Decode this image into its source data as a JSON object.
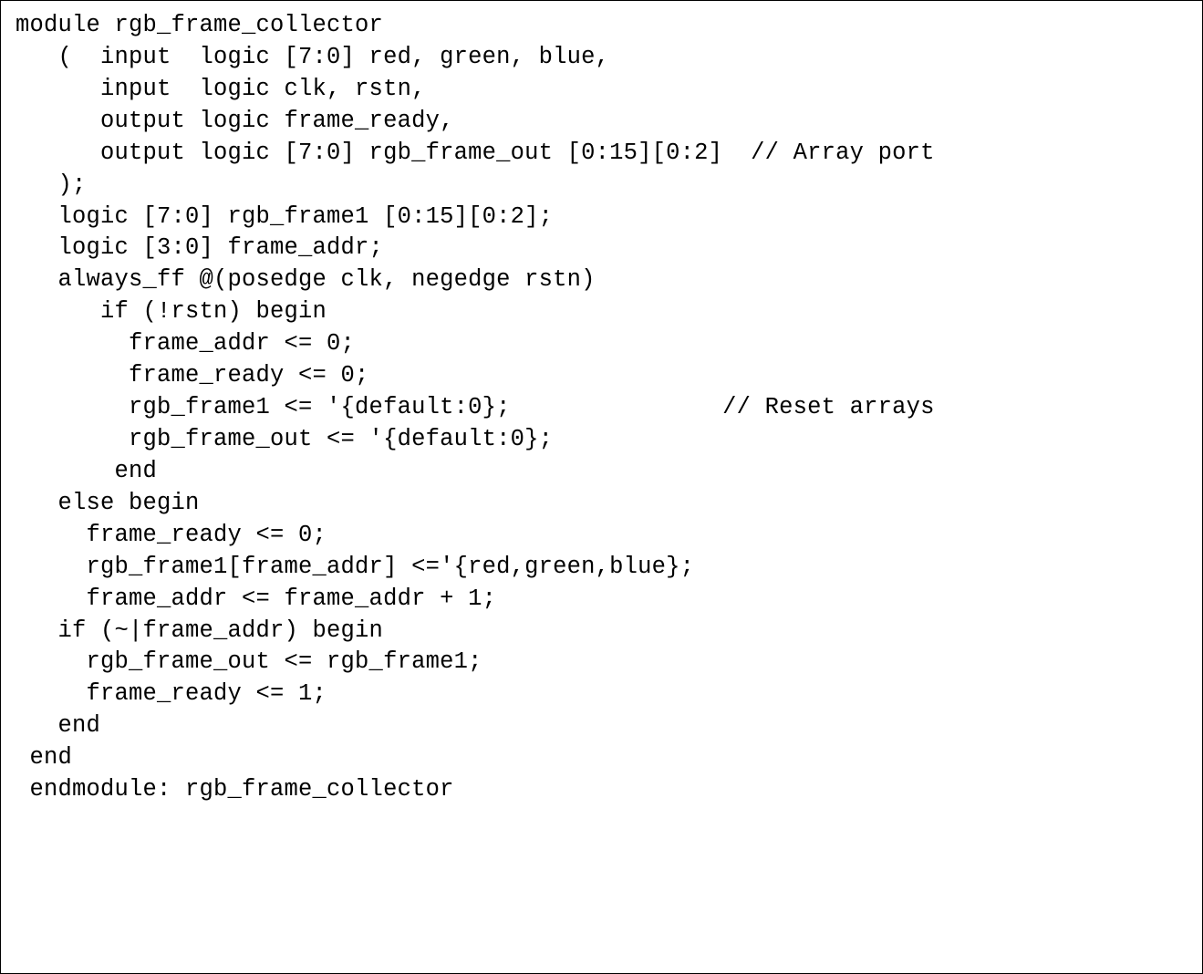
{
  "code": {
    "lines": [
      "module rgb_frame_collector",
      "   (  input  logic [7:0] red, green, blue,",
      "      input  logic clk, rstn,",
      "      output logic frame_ready,",
      "      output logic [7:0] rgb_frame_out [0:15][0:2]  // Array port",
      "   );",
      "",
      "   logic [7:0] rgb_frame1 [0:15][0:2];",
      "   logic [3:0] frame_addr;",
      "   always_ff @(posedge clk, negedge rstn)",
      "      if (!rstn) begin",
      "        frame_addr <= 0;",
      "        frame_ready <= 0;",
      "        rgb_frame1 <= '{default:0};               // Reset arrays",
      "        rgb_frame_out <= '{default:0};",
      "       end",
      "   else begin",
      "     frame_ready <= 0;",
      "     rgb_frame1[frame_addr] <='{red,green,blue};",
      "     frame_addr <= frame_addr + 1;",
      "   if (~|frame_addr) begin",
      "     rgb_frame_out <= rgb_frame1;",
      "     frame_ready <= 1;",
      "   end",
      " end",
      " endmodule: rgb_frame_collector"
    ]
  }
}
